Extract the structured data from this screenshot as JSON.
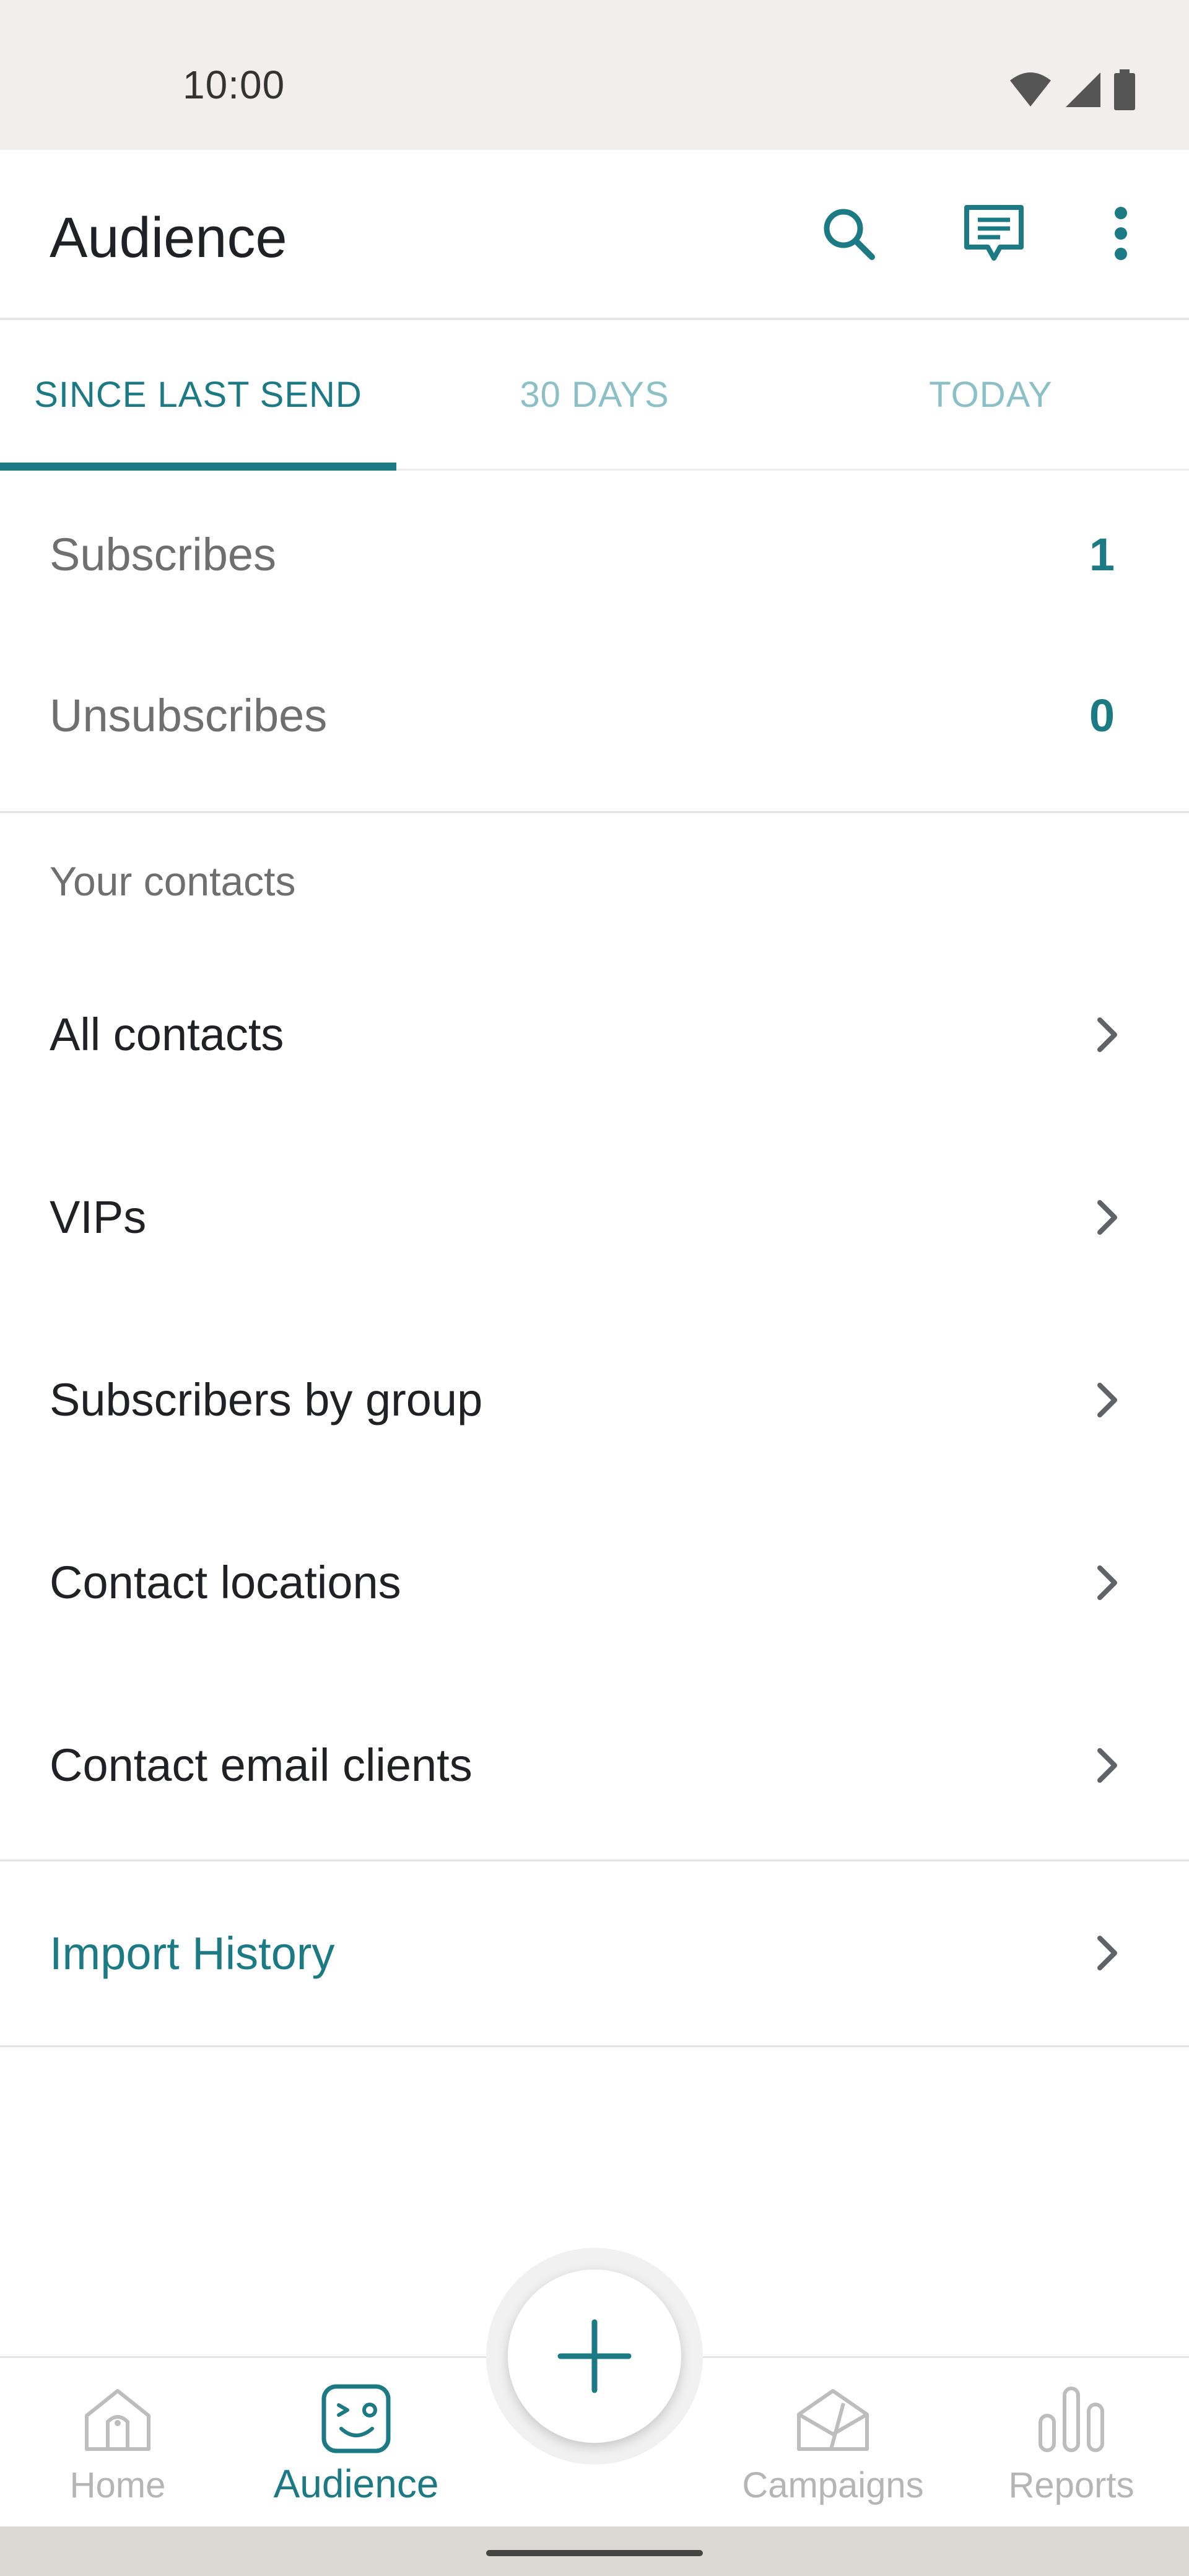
{
  "status_bar": {
    "time": "10:00"
  },
  "app_bar": {
    "title": "Audience"
  },
  "tabs": [
    {
      "label": "SINCE LAST SEND",
      "active": true
    },
    {
      "label": "30 DAYS",
      "active": false
    },
    {
      "label": "TODAY",
      "active": false
    }
  ],
  "stats": [
    {
      "label": "Subscribes",
      "value": "1"
    },
    {
      "label": "Unsubscribes",
      "value": "0"
    }
  ],
  "contacts": {
    "header": "Your contacts",
    "items": [
      {
        "label": "All contacts"
      },
      {
        "label": "VIPs"
      },
      {
        "label": "Subscribers by group"
      },
      {
        "label": "Contact locations"
      },
      {
        "label": "Contact email clients"
      }
    ]
  },
  "import_history": {
    "label": "Import History"
  },
  "bottom_nav": {
    "items": [
      {
        "label": "Home",
        "icon": "home-icon",
        "active": false
      },
      {
        "label": "Audience",
        "icon": "audience-face-icon",
        "active": true
      },
      {
        "label": "Campaigns",
        "icon": "campaigns-icon",
        "active": false
      },
      {
        "label": "Reports",
        "icon": "reports-bar-icon",
        "active": false
      }
    ],
    "fab_icon": "plus-icon"
  },
  "colors": {
    "accent": "#1b7a84",
    "accent_light": "#8bc1c6",
    "status_bar_bg": "#f2eeee",
    "muted_text": "#6f6f6f"
  }
}
